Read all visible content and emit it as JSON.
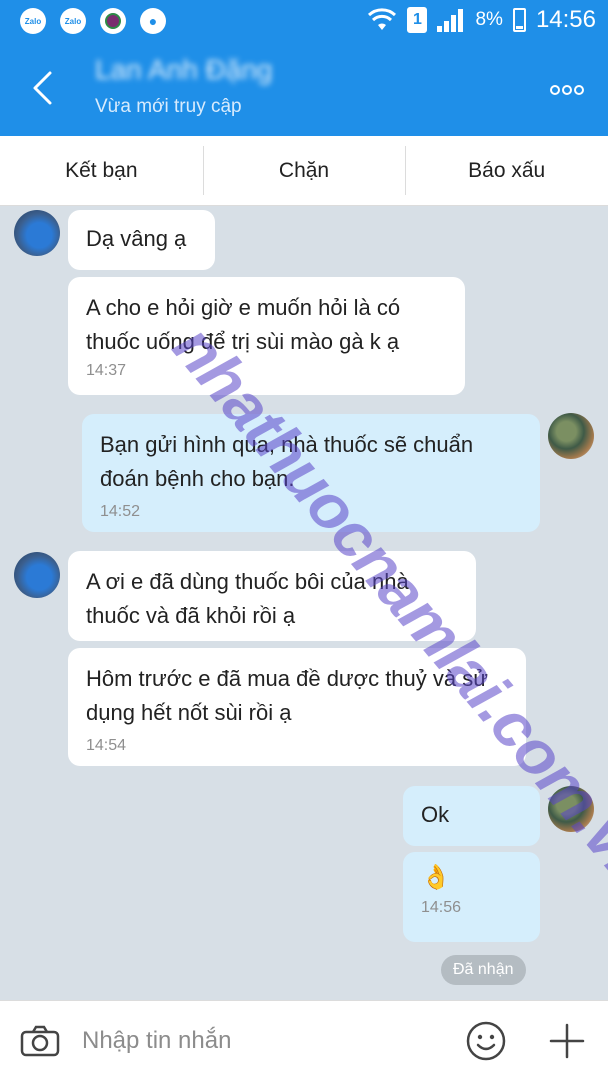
{
  "status_bar": {
    "apps": [
      "Zalo",
      "Zalo"
    ],
    "sim": "1",
    "battery": "8%",
    "time": "14:56"
  },
  "header": {
    "contact_name": "Lan Anh Đặng",
    "status": "Vừa mới truy cập",
    "more_label": "•••"
  },
  "actions": {
    "add_friend": "Kết bạn",
    "block": "Chặn",
    "report": "Báo xấu"
  },
  "messages": [
    {
      "direction": "in",
      "text": "Dạ vâng ạ",
      "time": ""
    },
    {
      "direction": "in",
      "text": "A cho e hỏi giờ e muốn hỏi là có thuốc uống để trị sùi mào gà k ạ",
      "time": "14:37"
    },
    {
      "direction": "out",
      "text": "Bạn gửi hình qua, nhà thuốc sẽ chuẩn đoán bệnh cho bạn.",
      "time": "14:52"
    },
    {
      "direction": "in",
      "text": "A ơi e đã dùng thuốc bôi của nhà thuốc và đã khỏi rồi ạ",
      "time": ""
    },
    {
      "direction": "in",
      "text": "Hôm trước e đã mua đề dược thuỷ và sử dụng hết nốt sùi rồi ạ",
      "time": "14:54"
    },
    {
      "direction": "out",
      "text": "Ok",
      "time": ""
    },
    {
      "direction": "out",
      "text": "👌",
      "time": "14:56"
    }
  ],
  "delivered_label": "Đã nhận",
  "input": {
    "placeholder": "Nhập tin nhắn"
  },
  "watermark": "nhathuocnamlai.com.vn",
  "colors": {
    "brand": "#1f8fe8",
    "chat_background": "#d7dfe6",
    "incoming_bubble": "#ffffff",
    "outgoing_bubble": "#d5eefc"
  },
  "icons": [
    "back-icon",
    "more-icon",
    "camera-icon",
    "emoji-icon",
    "plus-icon",
    "wifi-icon",
    "signal-icon",
    "battery-icon"
  ]
}
